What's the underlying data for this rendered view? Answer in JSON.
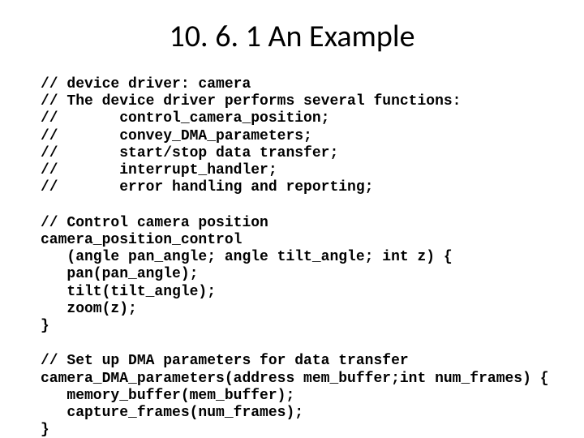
{
  "title": "10. 6. 1 An Example",
  "code_block_1": "// device driver: camera\n// The device driver performs several functions:\n//       control_camera_position;\n//       convey_DMA_parameters;\n//       start/stop data transfer;\n//       interrupt_handler;\n//       error handling and reporting;",
  "code_block_2": "// Control camera position\ncamera_position_control\n   (angle pan_angle; angle tilt_angle; int z) {\n   pan(pan_angle);\n   tilt(tilt_angle);\n   zoom(z);\n}",
  "code_block_3": "// Set up DMA parameters for data transfer\ncamera_DMA_parameters(address mem_buffer;int num_frames) {\n   memory_buffer(mem_buffer);\n   capture_frames(num_frames);\n}"
}
